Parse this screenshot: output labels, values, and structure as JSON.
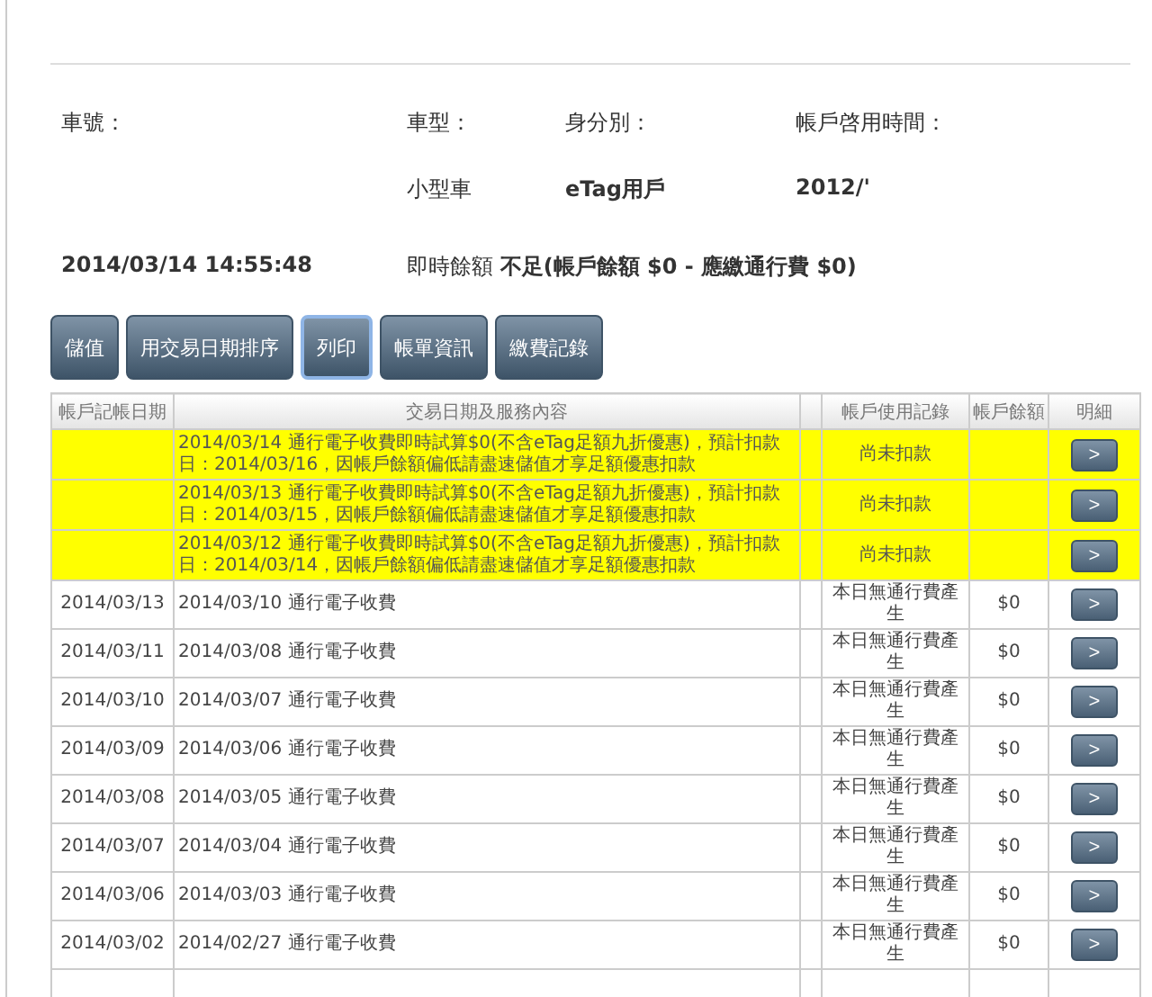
{
  "info": {
    "labels": [
      "車號：",
      "車型：",
      "身分別：",
      "帳戶啓用時間："
    ],
    "values": [
      "小型車",
      "eTag用戶",
      "2012/'"
    ],
    "timestamp": "2014/03/14 14:55:48",
    "balance": "即時餘額 **不足(帳戶餘額 $0 - 應繳通行費 $0)**"
  },
  "buttons": [
    {
      "label": "儲值",
      "focused": false
    },
    {
      "label": "用交易日期排序",
      "focused": false
    },
    {
      "label": "列印",
      "focused": true
    },
    {
      "label": "帳單資訊",
      "focused": false
    },
    {
      "label": "繳費記錄",
      "focused": false
    }
  ],
  "table": {
    "columns": [
      "帳戶記帳日期",
      "交易日期及服務內容",
      "帳戶使用記錄",
      "帳戶餘額",
      "明細"
    ],
    "rows": [
      {
        "highlighted": true,
        "date": "",
        "content": "2014/03/14 通行電子收費即時試算$0(不含eTag足額九折優惠)，預計扣款日：2014/03/16，因帳戶餘額偏低請盡速儲值才享足額優惠扣款",
        "usage": "尚未扣款",
        "balance": "",
        "detail": ">"
      },
      {
        "highlighted": true,
        "date": "",
        "content": "2014/03/13 通行電子收費即時試算$0(不含eTag足額九折優惠)，預計扣款日：2014/03/15，因帳戶餘額偏低請盡速儲值才享足額優惠扣款",
        "usage": "尚未扣款",
        "balance": "",
        "detail": ">"
      },
      {
        "highlighted": true,
        "date": "",
        "content": "2014/03/12 通行電子收費即時試算$0(不含eTag足額九折優惠)，預計扣款日：2014/03/14，因帳戶餘額偏低請盡速儲值才享足額優惠扣款",
        "usage": "尚未扣款",
        "balance": "",
        "detail": ">"
      },
      {
        "highlighted": false,
        "date": "2014/03/13",
        "content": "2014/03/10 通行電子收費",
        "usage": "本日無通行費產生",
        "balance": "$0",
        "detail": ">"
      },
      {
        "highlighted": false,
        "date": "2014/03/11",
        "content": "2014/03/08 通行電子收費",
        "usage": "本日無通行費產生",
        "balance": "$0",
        "detail": ">"
      },
      {
        "highlighted": false,
        "date": "2014/03/10",
        "content": "2014/03/07 通行電子收費",
        "usage": "本日無通行費產生",
        "balance": "$0",
        "detail": ">"
      },
      {
        "highlighted": false,
        "date": "2014/03/09",
        "content": "2014/03/06 通行電子收費",
        "usage": "本日無通行費產生",
        "balance": "$0",
        "detail": ">"
      },
      {
        "highlighted": false,
        "date": "2014/03/08",
        "content": "2014/03/05 通行電子收費",
        "usage": "本日無通行費產生",
        "balance": "$0",
        "detail": ">"
      },
      {
        "highlighted": false,
        "date": "2014/03/07",
        "content": "2014/03/04 通行電子收費",
        "usage": "本日無通行費產生",
        "balance": "$0",
        "detail": ">"
      },
      {
        "highlighted": false,
        "date": "2014/03/06",
        "content": "2014/03/03 通行電子收費",
        "usage": "本日無通行費產生",
        "balance": "$0",
        "detail": ">"
      },
      {
        "highlighted": false,
        "date": "2014/03/02",
        "content": "2014/02/27 通行電子收費",
        "usage": "本日無通行費產生",
        "balance": "$0",
        "detail": ">"
      }
    ]
  }
}
